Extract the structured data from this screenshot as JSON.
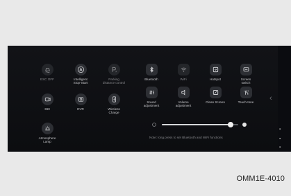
{
  "left_controls": [
    {
      "name": "esc-off",
      "icon": "esc-car-icon",
      "label": "ESC OFF",
      "state": "dim"
    },
    {
      "name": "intelligent-stop-start",
      "icon": "auto-a-icon",
      "label": "Intelligent\nStop-Start",
      "state": "normal"
    },
    {
      "name": "parking-distance-control",
      "icon": "parking-icon",
      "label": "Parking\ndistance control",
      "state": "dim"
    },
    {
      "name": "360",
      "icon": "camera-360-icon",
      "label": "360",
      "state": "normal"
    },
    {
      "name": "dvr",
      "icon": "dvr-icon",
      "label": "DVR",
      "state": "normal"
    },
    {
      "name": "wireless-charge",
      "icon": "phone-charge-icon",
      "label": "Wireless\nCharge",
      "state": "normal"
    },
    {
      "name": "atmosphere-lamp",
      "icon": "ambient-lamp-icon",
      "label": "Atmosphere\nLamp",
      "state": "normal"
    }
  ],
  "right_controls": [
    {
      "name": "bluetooth",
      "icon": "bluetooth-icon",
      "label": "Bluetooth",
      "state": "normal"
    },
    {
      "name": "wifi",
      "icon": "wifi-icon",
      "label": "WiFi",
      "state": "dim"
    },
    {
      "name": "hotspot",
      "icon": "hotspot-icon",
      "label": "Hotspot",
      "state": "normal"
    },
    {
      "name": "screen-switch",
      "icon": "screen-switch-icon",
      "label": "Screen\nswitch",
      "state": "normal"
    },
    {
      "name": "sound-adjustment",
      "icon": "equalizer-icon",
      "label": "Sound\nadjustment",
      "state": "normal"
    },
    {
      "name": "volume-adjustment",
      "icon": "speaker-icon",
      "label": "Volume\nadjustment",
      "state": "normal"
    },
    {
      "name": "clean-screen",
      "icon": "clean-screen-icon",
      "label": "Clean Screen",
      "state": "normal"
    },
    {
      "name": "touch-tone",
      "icon": "touch-tone-icon",
      "label": "Touch-tone",
      "state": "normal"
    }
  ],
  "brightness": {
    "level": 0.9
  },
  "note": "Note: long press to set Bluetooth and WiFi functions",
  "collapse_icon": "chevron-left-icon",
  "figure_code": "OMM1E-4010"
}
